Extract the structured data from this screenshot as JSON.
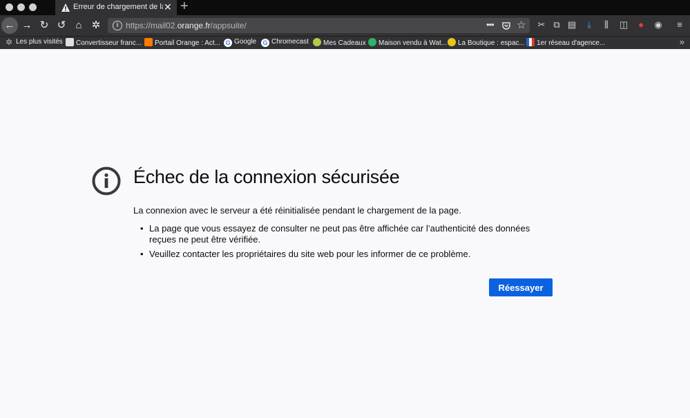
{
  "window": {
    "tab_title": "Erreur de chargement de la page",
    "tab_close": "✕",
    "new_tab": "+"
  },
  "navbar": {
    "url_prefix": "https://mail02.",
    "url_domain": "orange.fr",
    "url_path": "/appsuite/",
    "page_actions": "•••"
  },
  "bookmarks": [
    {
      "label": "Les plus visités",
      "icon": "gear-icon",
      "color": "#9a9a9a"
    },
    {
      "label": "Convertisseur franc...",
      "icon": "doc-icon",
      "color": "#e0e0e0"
    },
    {
      "label": "Portail Orange : Act...",
      "icon": "orange-icon",
      "color": "#ff7900"
    },
    {
      "label": "Google",
      "icon": "google-icon",
      "color": "#ffffff"
    },
    {
      "label": "Chromecast",
      "icon": "google-icon",
      "color": "#ffffff"
    },
    {
      "label": "Mes Cadeaux",
      "icon": "gift-icon",
      "color": "#b6c94a"
    },
    {
      "label": "Maison vendu à Wat...",
      "icon": "triangle-icon",
      "color": "#2fb36b"
    },
    {
      "label": "La Boutique : espac...",
      "icon": "lemon-icon",
      "color": "#e8c51a"
    },
    {
      "label": "1er réseau d'agence...",
      "icon": "flag-icon",
      "color": "#d83a2c"
    }
  ],
  "error": {
    "title": "Échec de la connexion sécurisée",
    "description": "La connexion avec le serveur a été réinitialisée pendant le chargement de la page.",
    "bullets": [
      "La page que vous essayez de consulter ne peut pas être affichée car l’authenticité des données reçues ne peut être vérifiée.",
      "Veuillez contacter les propriétaires du site web pour les informer de ce problème."
    ],
    "retry_label": "Réessayer"
  },
  "colors": {
    "accent": "#0a62e0",
    "chrome_dark": "#323234",
    "page_bg": "#f9f9fb"
  }
}
